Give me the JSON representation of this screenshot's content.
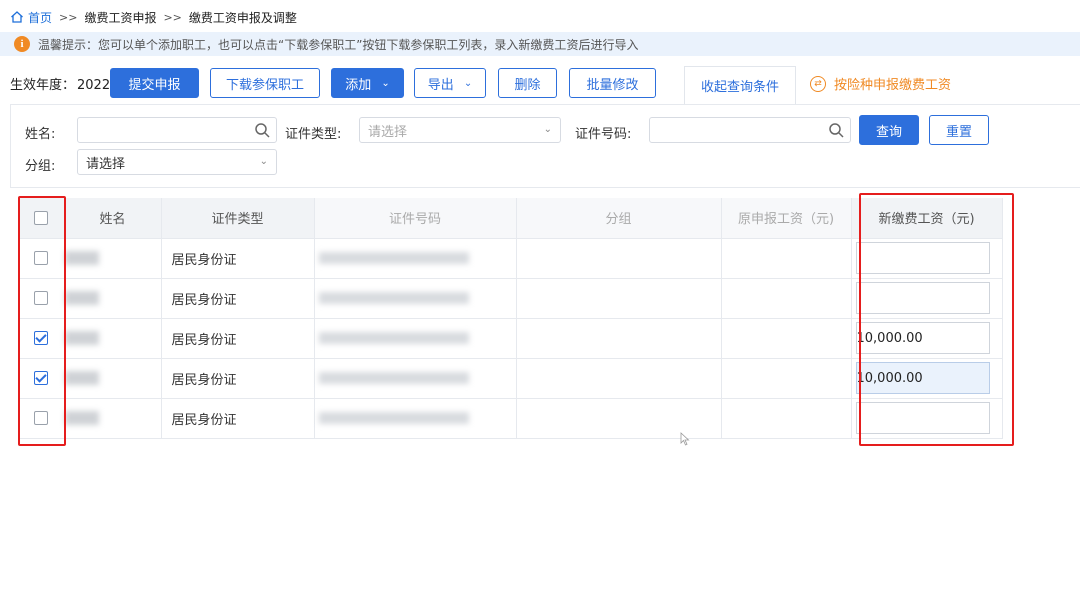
{
  "breadcrumb": {
    "home": "首页",
    "separator": ">>",
    "items": [
      "缴费工资申报",
      "缴费工资申报及调整"
    ]
  },
  "notice": {
    "text": "温馨提示：您可以单个添加职工，也可以点击“下载参保职工”按钮下载参保职工列表，录入新缴费工资后进行导入"
  },
  "toolbar": {
    "year_label": "生效年度：",
    "year": "2022",
    "submit": "提交申报",
    "download": "下载参保职工",
    "add": "添加",
    "export": "导出",
    "delete": "删除",
    "batch_edit": "批量修改",
    "collapse_tab": "收起查询条件",
    "switch_link": "按险种申报缴费工资"
  },
  "query": {
    "name_label": "姓名:",
    "name_value": "",
    "id_type_label": "证件类型:",
    "id_type_placeholder": "请选择",
    "id_number_label": "证件号码:",
    "id_number_value": "",
    "group_label": "分组:",
    "group_value": "请选择",
    "search_button": "查询",
    "reset_button": "重置"
  },
  "table": {
    "headers": {
      "name": "姓名",
      "id_type": "证件类型",
      "id_number": "证件号码",
      "group": "分组",
      "old_wage": "原申报工资（元)",
      "new_wage": "新缴费工资（元)"
    },
    "rows": [
      {
        "checked": false,
        "id_type": "居民身份证",
        "new_wage": ""
      },
      {
        "checked": false,
        "id_type": "居民身份证",
        "new_wage": ""
      },
      {
        "checked": true,
        "id_type": "居民身份证",
        "new_wage": "10,000.00"
      },
      {
        "checked": true,
        "id_type": "居民身份证",
        "new_wage": "10,000.00"
      },
      {
        "checked": false,
        "id_type": "居民身份证",
        "new_wage": ""
      }
    ]
  },
  "colors": {
    "primary": "#2d6fdc",
    "highlight": "#e51d1d",
    "accent_orange": "#f08a24",
    "notice_bg": "#eaf2fc"
  }
}
